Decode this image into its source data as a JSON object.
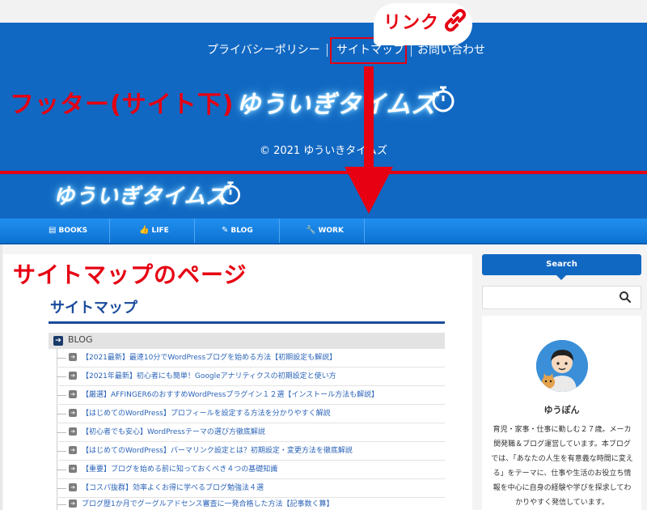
{
  "footer": {
    "nav": {
      "privacy": "プライバシーポリシー",
      "sitemap": "サイトマップ",
      "contact": "お問い合わせ"
    },
    "site_name": "ゆういぎタイムズ",
    "copyright": "© 2021 ゆういきタイムズ"
  },
  "annotations": {
    "link_label": "リンク",
    "footer_label": "フッター(サイト下)",
    "sitemap_page_label": "サイトマップのページ",
    "accent_color": "#e60012"
  },
  "header": {
    "site_name": "ゆういぎタイムズ",
    "nav": [
      {
        "label": "BOOKS",
        "icon": "book-icon"
      },
      {
        "label": "LIFE",
        "icon": "thumbs-up-icon"
      },
      {
        "label": "BLOG",
        "icon": "edit-icon"
      },
      {
        "label": "WORK",
        "icon": "wrench-icon"
      }
    ],
    "brand_color": "#1168c2"
  },
  "main": {
    "page_title": "サイトマップ",
    "category": "BLOG",
    "items": [
      "【2021最新】最速10分でWordPressブログを始める方法【初期設定も解説】",
      "【2021年最新】初心者にも簡単！Googleアナリティクスの初期設定と使い方",
      "【厳選】AFFINGER6のおすすめWordPressプラグイン１２選【インストール方法も解説】",
      "【はじめてのWordPress】プロフィールを設定する方法を分かりやすく解説",
      "【初心者でも安心】WordPressテーマの選び方徹底解説",
      "【はじめてのWordPress】パーマリンク設定とは？初期設定・変更方法を徹底解説",
      "【重要】ブログを始める前に知っておくべき４つの基礎知識",
      "【コスパ抜群】効率よくお得に学べるブログ勉強法４選",
      "ブログ歴1か月でグーグルアドセンス審査に一発合格した方法【記事数く算】"
    ]
  },
  "sidebar": {
    "search_title": "Search",
    "search_placeholder": "",
    "profile_name": "ゆうぽん",
    "profile_bio": "育児・家事・仕事に勤しむ２７歳。メーカ関発職＆ブログ運営しています。本ブログでは、「あなたの人生を有意義な時間に変える」をテーマに、仕事や生活のお役立ち情報を中心に自身の経験や学びを探求してわかりやすく発信しています。"
  }
}
